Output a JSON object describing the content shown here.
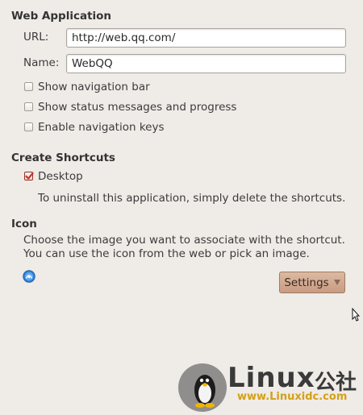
{
  "web_application": {
    "title": "Web Application",
    "url_label": "URL:",
    "url_value": "http://web.qq.com/",
    "name_label": "Name:",
    "name_value": "WebQQ",
    "options": [
      {
        "label": "Show navigation bar",
        "checked": false
      },
      {
        "label": "Show status messages and progress",
        "checked": false
      },
      {
        "label": "Enable navigation keys",
        "checked": false
      }
    ]
  },
  "create_shortcuts": {
    "title": "Create Shortcuts",
    "desktop_label": "Desktop",
    "desktop_checked": true,
    "uninstall_note": "To uninstall this application, simply delete the shortcuts."
  },
  "icon_section": {
    "title": "Icon",
    "description_line1": "Choose the image you want to associate with the shortcut.",
    "description_line2": "You can use the icon from the web or pick an image.",
    "icon_name": "web-globe-icon",
    "settings_label": "Settings"
  },
  "watermark": {
    "brand": "Linux",
    "suffix": "公社",
    "url": "www.Linuxidc.com"
  },
  "colors": {
    "background": "#efebe7",
    "button": "#c89c82",
    "checkbox_checked": "#c0392b",
    "globe": "#2d7fd6"
  }
}
